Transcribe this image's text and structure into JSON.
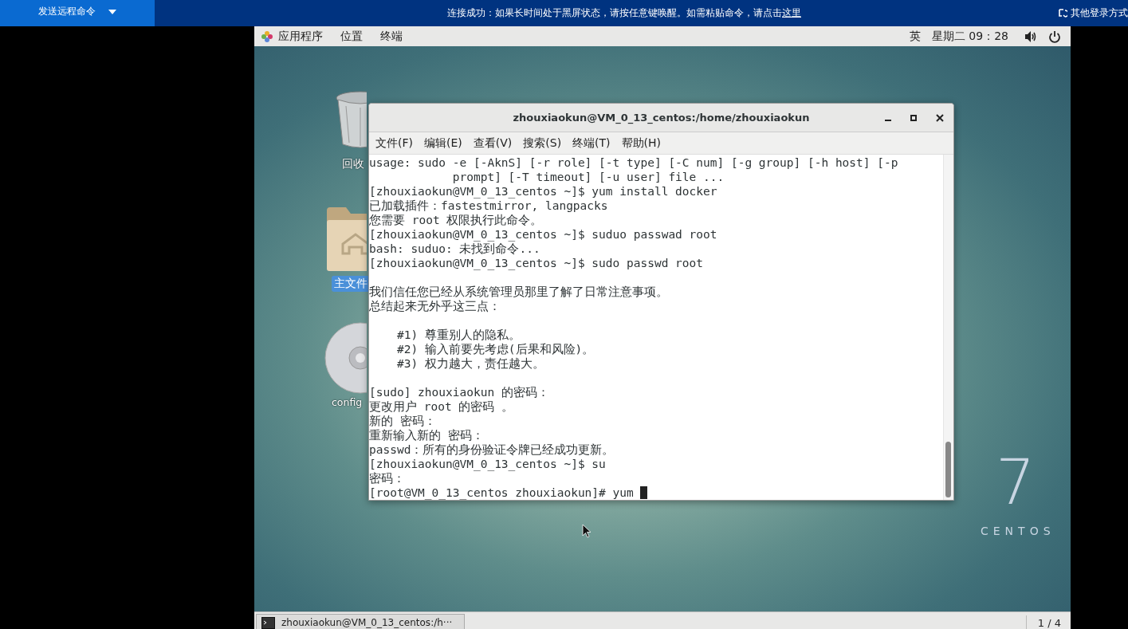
{
  "remote_bar": {
    "send_command": "发送远程命令",
    "notice": "连接成功：如果长时间处于黑屏状态，请按任意键唤醒。如需粘贴命令，请点击",
    "notice_link": "这里",
    "other_login": "其他登录方式"
  },
  "top_panel": {
    "menus": [
      "应用程序",
      "位置",
      "终端"
    ],
    "input_method": "英",
    "clock": "星期二 09：28"
  },
  "desktop_icons": [
    {
      "kind": "trash",
      "label": "回收",
      "selected": false
    },
    {
      "kind": "folder",
      "label": "主文件",
      "selected": true
    },
    {
      "kind": "disc",
      "label": "config",
      "selected": false
    }
  ],
  "terminal": {
    "title": "zhouxiaokun@VM_0_13_centos:/home/zhouxiaokun",
    "menus": [
      "文件(F)",
      "编辑(E)",
      "查看(V)",
      "搜索(S)",
      "终端(T)",
      "帮助(H)"
    ],
    "blocks": [
      [
        "usage: sudo -e [-AknS] [-r role] [-t type] [-C num] [-g group] [-h host] [-p",
        "            prompt] [-T timeout] [-u user] file ...",
        "[zhouxiaokun@VM_0_13_centos ~]$ yum install docker",
        "已加载插件：fastestmirror, langpacks",
        "您需要 root 权限执行此命令。",
        "[zhouxiaokun@VM_0_13_centos ~]$ suduo passwad root",
        "bash: suduo: 未找到命令...",
        "[zhouxiaokun@VM_0_13_centos ~]$ sudo passwd root"
      ],
      [
        "我们信任您已经从系统管理员那里了解了日常注意事项。",
        "总结起来无外乎这三点："
      ],
      [
        "    #1) 尊重别人的隐私。",
        "    #2) 输入前要先考虑(后果和风险)。",
        "    #3) 权力越大，责任越大。"
      ],
      [
        "[sudo] zhouxiaokun 的密码：",
        "更改用户 root 的密码 。",
        "新的 密码：",
        "重新输入新的 密码：",
        "passwd：所有的身份验证令牌已经成功更新。",
        "[zhouxiaokun@VM_0_13_centos ~]$ su",
        "密码：",
        "[root@VM_0_13_centos zhouxiaokun]# yum "
      ]
    ],
    "cursor": true
  },
  "logo": {
    "number": "7",
    "name": "CENTOS"
  },
  "taskbar": {
    "window_button": "zhouxiaokun@VM_0_13_centos:/h···",
    "workspace": "1 / 4"
  }
}
